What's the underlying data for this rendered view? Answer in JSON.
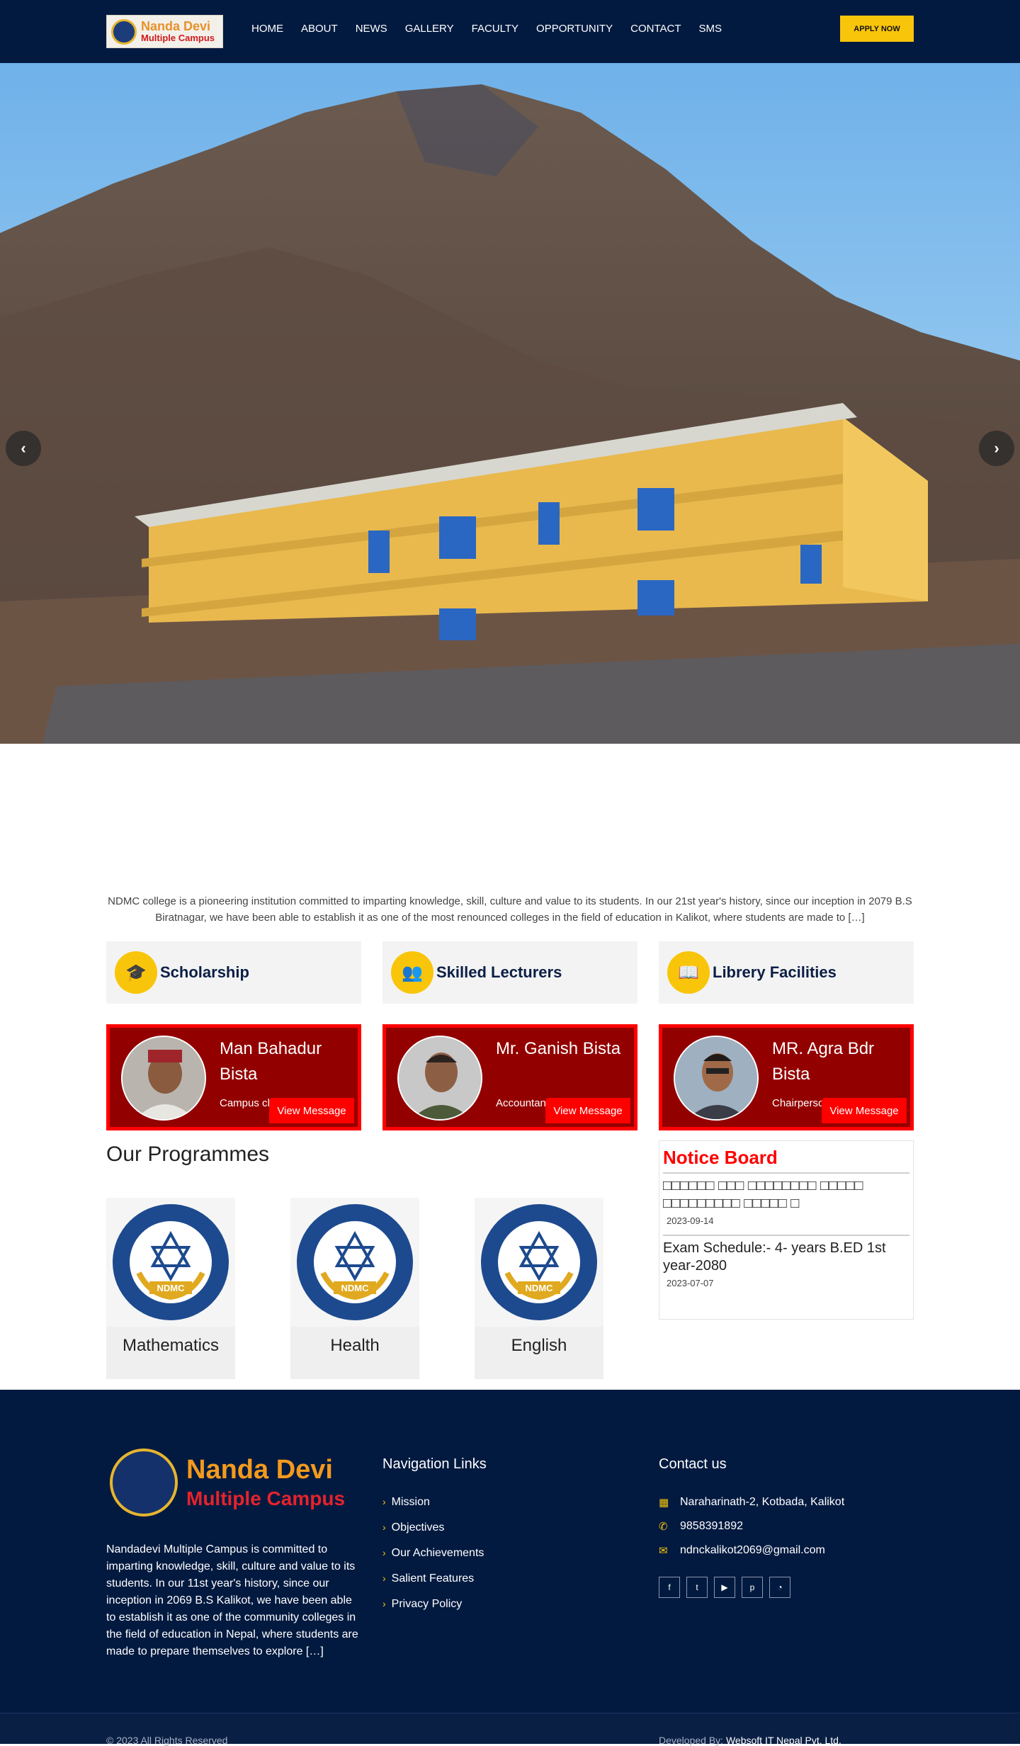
{
  "header": {
    "logo_line1": "Nanda Devi",
    "logo_line2": "Multiple Campus",
    "nav": [
      "HOME",
      "ABOUT",
      "NEWS",
      "GALLERY",
      "FACULTY",
      "OPPORTUNITY",
      "CONTACT",
      "SMS"
    ],
    "apply_label": "APPLY NOW"
  },
  "intro": "NDMC college is a pioneering institution committed to imparting knowledge, skill, culture and value to its students. In our 21st year's history, since our inception in 2079 B.S Biratnagar, we have been able to establish it as one of the most renounced colleges in the field of education in Kalikot, where students are made to […]",
  "features": [
    {
      "title": "Scholarship",
      "icon": "graduation-cap-icon"
    },
    {
      "title": "Skilled Lecturers",
      "icon": "users-icon"
    },
    {
      "title": "Librery Facilities",
      "icon": "book-icon"
    }
  ],
  "people": [
    {
      "name": "Man Bahadur Bista",
      "role": "Campus chief",
      "button": "View Message"
    },
    {
      "name": "Mr. Ganish Bista",
      "role": "Accountant",
      "button": "View Message"
    },
    {
      "name": "MR. Agra Bdr Bista",
      "role": "Chairperson",
      "button": "View Message"
    }
  ],
  "programmes": {
    "title": "Our Programmes",
    "items": [
      "Mathematics",
      "Health",
      "English"
    ],
    "emblem_text": "NDMC"
  },
  "notice": {
    "title": "Notice Board",
    "items": [
      {
        "title": "□□□□□□ □□□ □□□□□□□□ □□□□□ □□□□□□□□□ □□□□□ □",
        "date": "2023-09-14"
      },
      {
        "title": "Exam Schedule:- 4- years B.ED 1st year-2080",
        "date": "2023-07-07"
      }
    ]
  },
  "footer": {
    "logo_line1": "Nanda Devi",
    "logo_line2": "Multiple Campus",
    "about": "Nandadevi Multiple Campus is committed to imparting knowledge, skill, culture and value to its students. In our 11st year's history, since our inception in 2069 B.S Kalikot, we have been able to establish it as one of the community colleges in the field of education in Nepal, where students are made to prepare themselves to explore […]",
    "nav_title": "Navigation Links",
    "nav_links": [
      "Mission",
      "Objectives",
      "Our Achievements",
      "Salient Features",
      "Privacy Policy"
    ],
    "contact_title": "Contact us",
    "address": "Naraharinath-2, Kotbada, Kalikot",
    "phone": "9858391892",
    "email": "ndnckalikot2069@gmail.com",
    "socials": [
      "facebook-icon",
      "twitter-icon",
      "youtube-icon",
      "pinterest-icon",
      "rss-icon"
    ],
    "copyright": "© 2023 All Rights Reserved",
    "developed_by": "Developed By:",
    "developer": "Websoft IT Nepal Pvt. Ltd."
  },
  "colors": {
    "navy": "#031a40",
    "yellow": "#f9c50a",
    "red": "#ff0000",
    "dark_red": "#930000"
  }
}
